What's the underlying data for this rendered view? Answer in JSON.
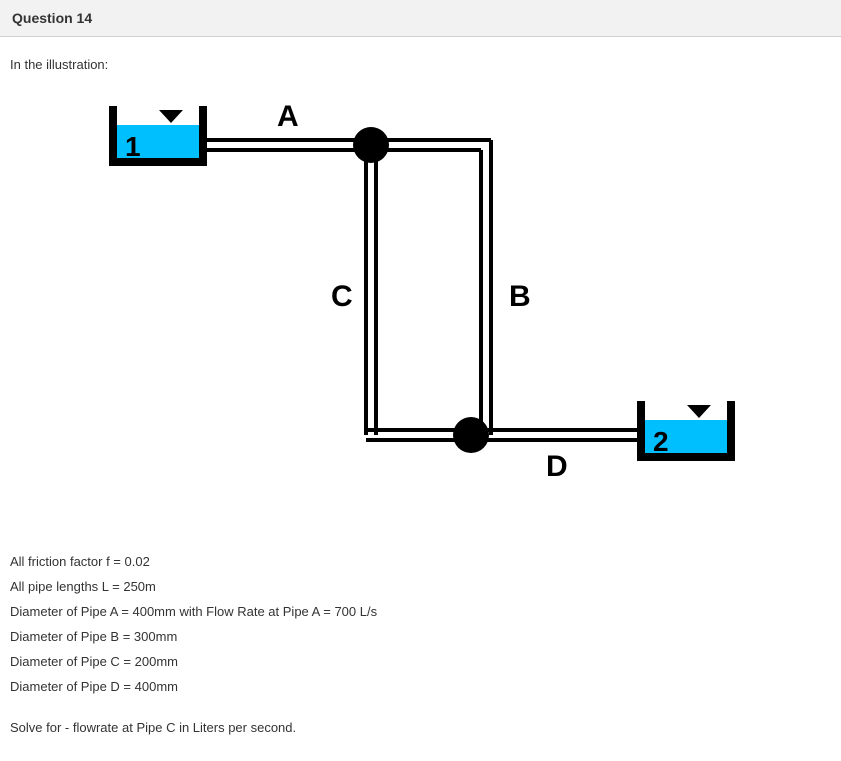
{
  "header": {
    "title": "Question 14"
  },
  "intro": "In the illustration:",
  "diagram": {
    "labelA": "A",
    "labelB": "B",
    "labelC": "C",
    "labelD": "D",
    "tank1": "1",
    "tank2": "2"
  },
  "specs": {
    "friction": "All friction factor f = 0.02",
    "lengths": "All pipe lengths L = 250m",
    "pipeA": "Diameter of Pipe A = 400mm with Flow Rate at Pipe A = 700 L/s",
    "pipeB": "Diameter of Pipe B = 300mm",
    "pipeC": "Diameter of Pipe C = 200mm",
    "pipeD": "Diameter of Pipe D = 400mm"
  },
  "solve": "Solve for - flowrate at Pipe C in Liters per second."
}
